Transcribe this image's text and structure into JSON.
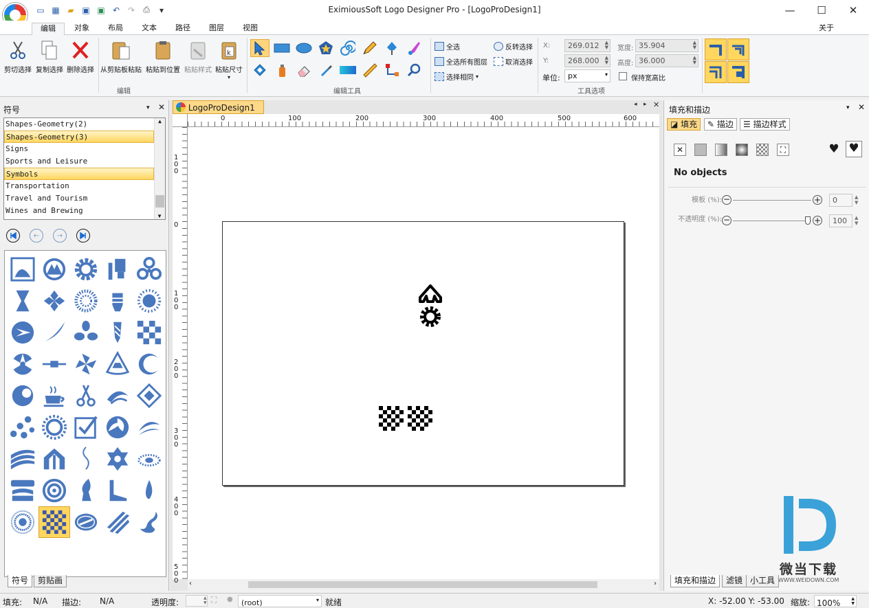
{
  "window": {
    "title": "EximiousSoft Logo Designer Pro - [LogoProDesign1]",
    "about": "关于"
  },
  "ribbon_tabs": [
    "编辑",
    "对象",
    "布局",
    "文本",
    "路径",
    "图层",
    "视图"
  ],
  "ribbon": {
    "edit_group": {
      "label": "编辑",
      "buttons": [
        "剪切选择",
        "复制选择",
        "删除选择",
        "从剪贴板粘贴",
        "粘贴到位置",
        "粘贴样式",
        "粘贴尺寸"
      ]
    },
    "tools_group": {
      "label": "编辑工具"
    },
    "select_group": {
      "select_all": "全选",
      "select_all_layers": "全选所有图层",
      "select_same": "选择相同",
      "invert": "反转选择",
      "deselect": "取消选择"
    },
    "options_group": {
      "label": "工具选项",
      "x_label": "X:",
      "x_value": "269.012",
      "y_label": "Y:",
      "y_value": "268.000",
      "w_label": "宽度:",
      "w_value": "35.904",
      "h_label": "高度:",
      "h_value": "36.000",
      "unit_label": "单位:",
      "unit_value": "px",
      "keep_ratio": "保持宽高比"
    }
  },
  "symbols_panel": {
    "title": "符号",
    "list": [
      "Shapes-Geometry(2)",
      "Shapes-Geometry(3)",
      "Signs",
      "Sports and Leisure",
      "Symbols",
      "Transportation",
      "Travel and Tourism",
      "Wines and Brewing"
    ],
    "highlighted": [
      "Shapes-Geometry(3)",
      "Symbols"
    ],
    "tabs": [
      "符号",
      "剪贴画"
    ]
  },
  "document": {
    "tab": "LogoProDesign1",
    "ruler_h": [
      "0",
      "100",
      "200",
      "300",
      "400",
      "500",
      "600"
    ],
    "ruler_v": [
      "100",
      "0",
      "100",
      "200",
      "300",
      "400",
      "500"
    ]
  },
  "fill_panel": {
    "title": "填充和描边",
    "tabs": [
      "填充",
      "描边",
      "描边样式"
    ],
    "no_objects": "No objects",
    "blur_label": "模板 (%):",
    "blur_value": "0",
    "opacity_label": "不透明度 (%):",
    "opacity_value": "100",
    "bottom_tabs": [
      "填充和描边",
      "滤镜",
      "小工具"
    ]
  },
  "watermark": {
    "title": "微当下载",
    "url": "WWW.WEIDOWN.COM"
  },
  "status": {
    "fill_label": "填充:",
    "fill_value": "N/A",
    "stroke_label": "描边:",
    "stroke_value": "N/A",
    "opacity_label": "透明度:",
    "root": "(root)",
    "ready": "就绪",
    "coords": "X: -52.00 Y: -53.00",
    "zoom_label": "缩放:",
    "zoom_value": "100%"
  },
  "colors": {
    "accent": "#2a5ea8",
    "symbol_blue": "#4a78be",
    "highlight": "#ffd65e",
    "ribbon_bg": "#f5f6f7"
  }
}
